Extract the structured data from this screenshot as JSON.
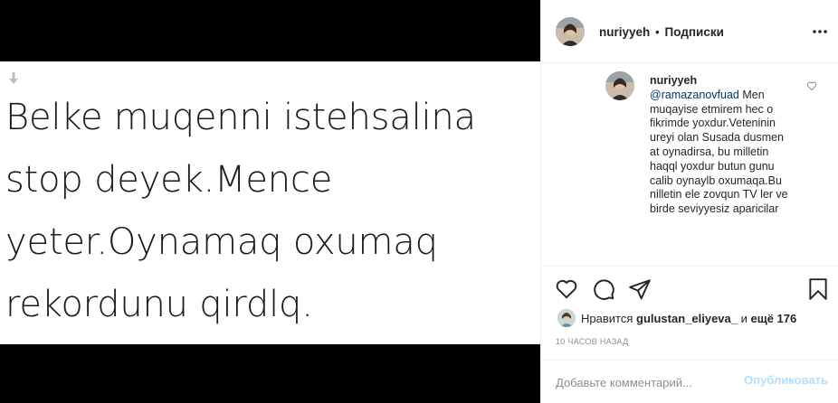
{
  "post": {
    "lines": [
      "Belke muqenni istehsalina",
      "stop deyek.Mence",
      "yeter.Oynamaq oxumaq",
      "rekordunu qirdlq."
    ],
    "arrow_icon": "arrow-down-icon"
  },
  "header": {
    "username": "nuriyyeh",
    "separator": "•",
    "follow_label": "Подписки",
    "more_icon": "more-horizontal-icon"
  },
  "comment": {
    "username": "nuriyyeh",
    "mention": "@ramazanovfuad",
    "text": " Men muqayise etmirem hec o fikrimde yoxdur.Veteninin ureyi olan Susada dusmen at oynadirsa, bu milletin haqql yoxdur butun gunu calib oynaylb oxumaqa.Bu nilletin ele zovqun TV ler ve birde seviyyesiz aparicilar"
  },
  "likes": {
    "prefix": "Нравится",
    "user": "gulustan_eliyeva_",
    "conjunction": "и",
    "count": "ещё 176"
  },
  "timestamp": "10 ЧАСОВ НАЗАД",
  "add_comment": {
    "placeholder": "Добавьте комментарий...",
    "post_label": "Опубликовать"
  },
  "colors": {
    "link": "#00376b",
    "post_disabled": "#b2dffc",
    "muted": "#8e8e8e",
    "media_background": "#000000"
  }
}
